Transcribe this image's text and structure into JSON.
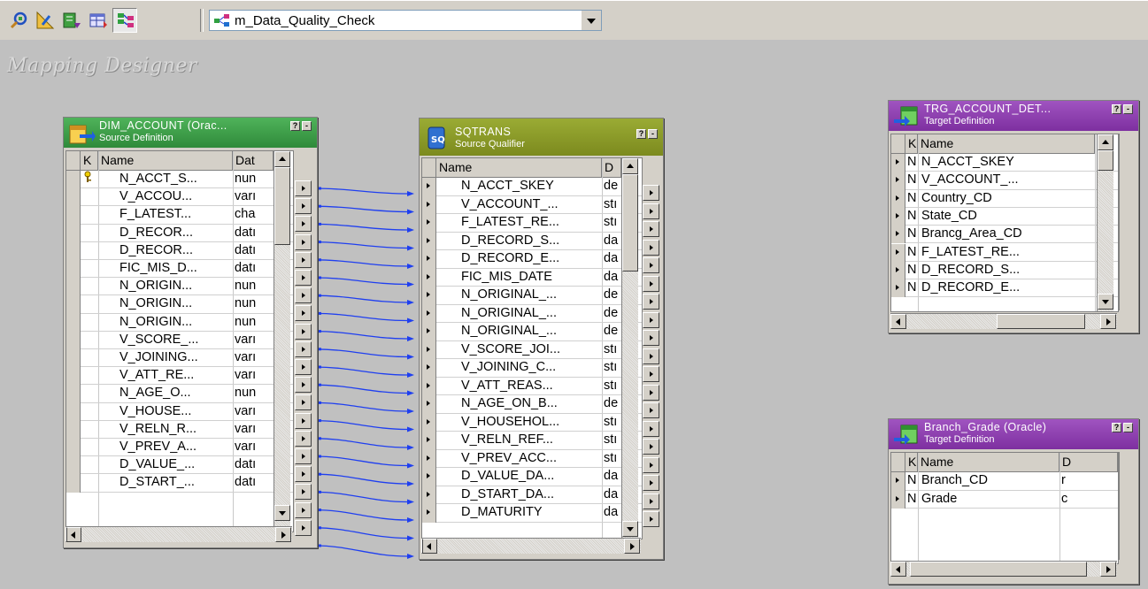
{
  "toolbar": {
    "buttons": [
      {
        "name": "source-analyzer-icon"
      },
      {
        "name": "target-designer-icon"
      },
      {
        "name": "transformation-developer-icon"
      },
      {
        "name": "mapplet-designer-icon"
      },
      {
        "name": "mapping-designer-icon"
      }
    ],
    "selected_mapping": "m_Data_Quality_Check"
  },
  "canvas": {
    "title": "Mapping Designer"
  },
  "colors": {
    "source_header": "#3f9a4a",
    "sq_header": "#8a9a2a",
    "target_header": "#8a3aa8",
    "link": "#1f3ff0"
  },
  "source_table": {
    "title": "DIM_ACCOUNT (Orac...",
    "subtitle": "Source Definition",
    "columns": [
      "K",
      "Name",
      "Dat"
    ],
    "rows": [
      {
        "key": "key-icon",
        "name": "N_ACCT_S...",
        "type": "nun"
      },
      {
        "key": "",
        "name": "V_ACCOU...",
        "type": "varı"
      },
      {
        "key": "",
        "name": "F_LATEST...",
        "type": "cha"
      },
      {
        "key": "",
        "name": "D_RECOR...",
        "type": "datı"
      },
      {
        "key": "",
        "name": "D_RECOR...",
        "type": "datı"
      },
      {
        "key": "",
        "name": "FIC_MIS_D...",
        "type": "datı"
      },
      {
        "key": "",
        "name": "N_ORIGIN...",
        "type": "nun"
      },
      {
        "key": "",
        "name": "N_ORIGIN...",
        "type": "nun"
      },
      {
        "key": "",
        "name": "N_ORIGIN...",
        "type": "nun"
      },
      {
        "key": "",
        "name": "V_SCORE_...",
        "type": "varı"
      },
      {
        "key": "",
        "name": "V_JOINING...",
        "type": "varı"
      },
      {
        "key": "",
        "name": "V_ATT_RE...",
        "type": "varı"
      },
      {
        "key": "",
        "name": "N_AGE_O...",
        "type": "nun"
      },
      {
        "key": "",
        "name": "V_HOUSE...",
        "type": "varı"
      },
      {
        "key": "",
        "name": "V_RELN_R...",
        "type": "varı"
      },
      {
        "key": "",
        "name": "V_PREV_A...",
        "type": "varı"
      },
      {
        "key": "",
        "name": "D_VALUE_...",
        "type": "datı"
      },
      {
        "key": "",
        "name": "D_START_...",
        "type": "datı"
      }
    ]
  },
  "sq_table": {
    "title": "SQTRANS",
    "subtitle": "Source Qualifier",
    "columns": [
      "Name",
      "D"
    ],
    "rows": [
      {
        "name": "N_ACCT_SKEY",
        "type": "de"
      },
      {
        "name": "V_ACCOUNT_...",
        "type": "stı"
      },
      {
        "name": "F_LATEST_RE...",
        "type": "stı"
      },
      {
        "name": "D_RECORD_S...",
        "type": "da"
      },
      {
        "name": "D_RECORD_E...",
        "type": "da"
      },
      {
        "name": "FIC_MIS_DATE",
        "type": "da"
      },
      {
        "name": "N_ORIGINAL_...",
        "type": "de"
      },
      {
        "name": "N_ORIGINAL_...",
        "type": "de"
      },
      {
        "name": "N_ORIGINAL_...",
        "type": "de"
      },
      {
        "name": "V_SCORE_JOI...",
        "type": "stı"
      },
      {
        "name": "V_JOINING_C...",
        "type": "stı"
      },
      {
        "name": "V_ATT_REAS...",
        "type": "stı"
      },
      {
        "name": "N_AGE_ON_B...",
        "type": "de"
      },
      {
        "name": "V_HOUSEHOL...",
        "type": "stı"
      },
      {
        "name": "V_RELN_REF...",
        "type": "stı"
      },
      {
        "name": "V_PREV_ACC...",
        "type": "stı"
      },
      {
        "name": "D_VALUE_DA...",
        "type": "da"
      },
      {
        "name": "D_START_DA...",
        "type": "da"
      },
      {
        "name": "D_MATURITY",
        "type": "da"
      }
    ]
  },
  "target_account": {
    "title": "TRG_ACCOUNT_DET...",
    "subtitle": "Target Definition",
    "columns": [
      "K",
      "Name"
    ],
    "rows": [
      {
        "key": "N",
        "name": "N_ACCT_SKEY"
      },
      {
        "key": "N",
        "name": "V_ACCOUNT_..."
      },
      {
        "key": "N",
        "name": "Country_CD"
      },
      {
        "key": "N",
        "name": "State_CD"
      },
      {
        "key": "N",
        "name": "Brancg_Area_CD"
      },
      {
        "key": "N",
        "name": "F_LATEST_RE..."
      },
      {
        "key": "N",
        "name": "D_RECORD_S..."
      },
      {
        "key": "N",
        "name": "D_RECORD_E..."
      }
    ]
  },
  "target_branch": {
    "title": "Branch_Grade (Oracle)",
    "subtitle": "Target Definition",
    "columns": [
      "K",
      "Name",
      "D"
    ],
    "rows": [
      {
        "key": "N",
        "name": "Branch_CD",
        "type": "r"
      },
      {
        "key": "N",
        "name": "Grade",
        "type": "c"
      }
    ]
  }
}
